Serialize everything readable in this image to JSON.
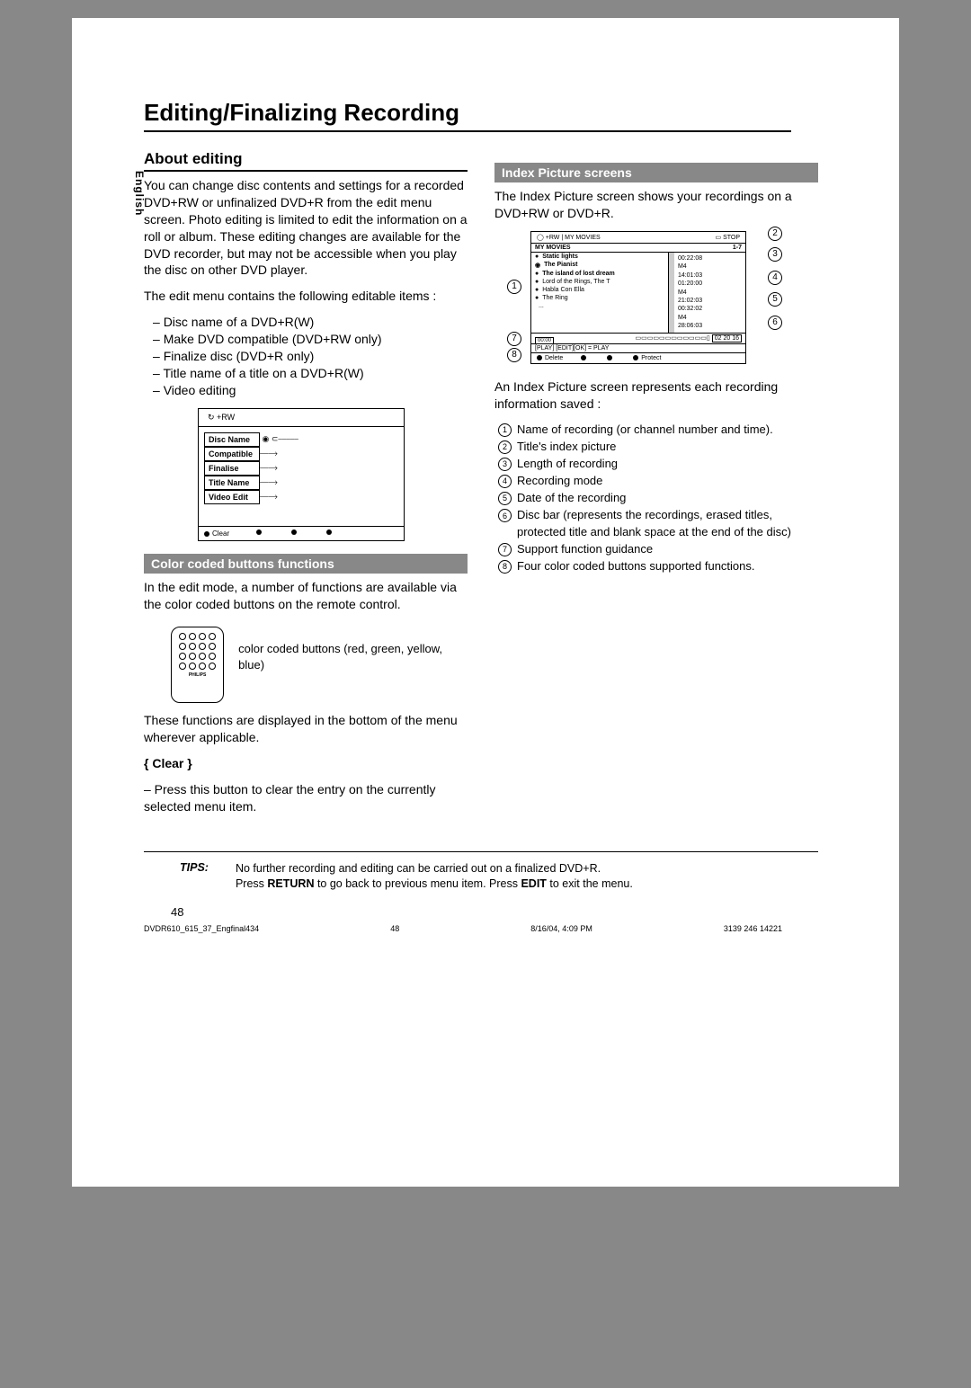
{
  "lang": "English",
  "title": "Editing/Finalizing Recording",
  "left": {
    "about_h": "About editing",
    "p1": "You can change disc contents and settings for a recorded DVD+RW or unfinalized DVD+R from the edit menu screen. Photo editing is limited to edit the information on a roll or album.  These editing changes are available for the DVD recorder, but may not be accessible when you play the disc on other DVD player.",
    "p2": "The edit menu contains the following editable items :",
    "items": [
      "Disc name of a DVD+R(W)",
      "Make DVD compatible (DVD+RW only)",
      "Finalize disc (DVD+R only)",
      "Title name of a title on a DVD+R(W)",
      "Video editing"
    ],
    "menu": {
      "hdr": "+RW",
      "rows": [
        "Disc Name",
        "Compatible",
        "Finalise",
        "Title Name",
        "Video Edit"
      ],
      "clear": "Clear"
    },
    "cc_bar": "Color coded buttons functions",
    "cc_p": "In the edit mode, a number of functions are available via the color coded buttons on the remote control.",
    "cc_cap": "color coded buttons (red, green, yellow, blue)",
    "brand": "PHILIPS",
    "cc_p2": "These functions are displayed in the bottom of the menu wherever applicable.",
    "clear_name": "{ Clear }",
    "clear_p": "–  Press this button to clear the entry on the currently selected menu item."
  },
  "right": {
    "ip_bar": "Index Picture screens",
    "ip_p": "The Index Picture screen shows your recordings on a DVD+RW or DVD+R.",
    "ip_top_l": "+RW | MY MOVIES",
    "ip_top_r": "STOP",
    "ip_title": "MY MOVIES",
    "ip_range": "1-7",
    "ip_list": [
      "Static lights",
      "The Pianist",
      "The island of lost dream",
      "Lord of the Rings, The T",
      "Habla Con Ella",
      "The Ring",
      "..."
    ],
    "ip_right": [
      "00:22:08",
      "M4",
      "14:01:03",
      "01:20:00",
      "M4",
      "21:02:03",
      "00:32:02",
      "M4",
      "28:06:03"
    ],
    "ip_bar_time": "02 20 16",
    "ip_time": "00:00",
    "ip_support": "[PLAY] [EDIT][OK] = PLAY",
    "ip_btm_l": "Delete",
    "ip_btm_r": "Protect",
    "ip_p2": "An Index Picture screen represents each recording information saved :",
    "legend": [
      "Name of recording (or channel number and time).",
      "Title's index picture",
      "Length of recording",
      "Recording mode",
      "Date of the recording",
      "Disc bar (represents the recordings, erased titles, protected title and blank space at the end of the disc)",
      "Support function guidance",
      "Four color coded buttons supported functions."
    ]
  },
  "tips": {
    "label": "TIPS:",
    "l1": "No further recording and editing can be carried out on a finalized DVD+R.",
    "l2_a": "Press ",
    "l2_b": "RETURN",
    "l2_c": " to go back to previous menu item.  Press ",
    "l2_d": "EDIT",
    "l2_e": " to exit the menu."
  },
  "page_num": "48",
  "ftr": {
    "file": "DVDR610_615_37_Engfinal434",
    "pg": "48",
    "date": "8/16/04, 4:09 PM",
    "code": "3139 246 14221"
  }
}
